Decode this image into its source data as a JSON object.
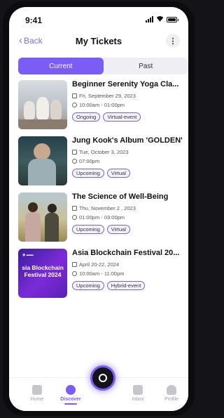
{
  "status_bar": {
    "time": "9:41"
  },
  "header": {
    "back_label": "Back",
    "title": "My Tickets",
    "more_label": "⋮"
  },
  "segments": [
    {
      "label": "Current",
      "active": true
    },
    {
      "label": "Past",
      "active": false
    }
  ],
  "events": [
    {
      "title": "Beginner Serenity Yoga Cla...",
      "date": "Fri, September 29, 2023",
      "time": "10:00am - 01:00pm",
      "tags": [
        "Ongoing",
        "Virtual-event"
      ]
    },
    {
      "title": "Jung Kook's Album 'GOLDEN'",
      "date": "Tue, October 3, 2023",
      "time": "07:00pm",
      "tags": [
        "Upcoming",
        "Virtual"
      ]
    },
    {
      "title": "The Science of Well-Being",
      "date": "Thu, November 2 , 2023",
      "time": "01:00pm - 03:00pm",
      "tags": [
        "Upcoming",
        "Virtual"
      ]
    },
    {
      "title": "Asia Blockchain Festival 20...",
      "date": "April 20-22, 2024",
      "time": "10:00am - 11:00pm",
      "tags": [
        "Upcoming",
        "Hybrid-event"
      ],
      "thumb_text": "sia Blockchain Festival 2024"
    }
  ],
  "bottom_nav": [
    {
      "label": "Home",
      "icon": "home-icon",
      "active": false
    },
    {
      "label": "Discover",
      "icon": "compass-icon",
      "active": true
    },
    {
      "label": "Inbox",
      "icon": "inbox-icon",
      "active": false
    },
    {
      "label": "Profile",
      "icon": "profile-icon",
      "active": false
    }
  ],
  "colors": {
    "accent": "#7b5cf5",
    "back_link": "#7c6cf0",
    "tag_bg": "#f5f3ff"
  }
}
